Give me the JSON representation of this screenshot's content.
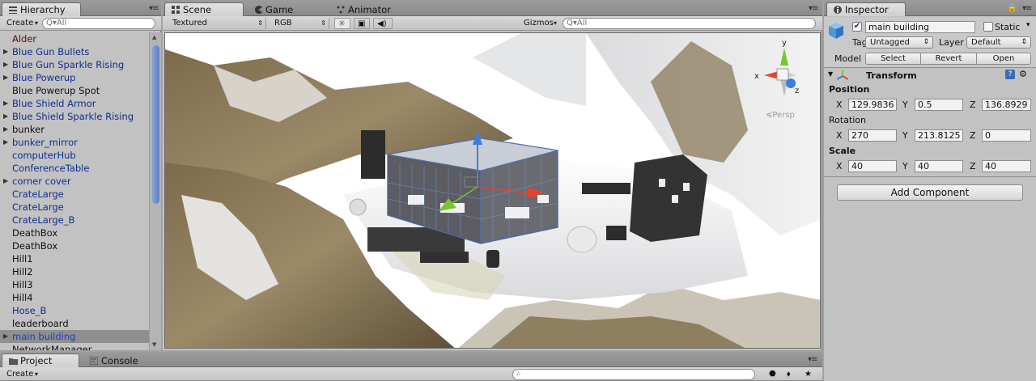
{
  "hierarchy": {
    "tab": "Hierarchy",
    "create": "Create",
    "search_placeholder": "Q▾All",
    "items": [
      {
        "label": "Alder",
        "kind": "broken",
        "fold": false
      },
      {
        "label": "Blue Gun Bullets",
        "kind": "prefab",
        "fold": true
      },
      {
        "label": "Blue Gun Sparkle Rising",
        "kind": "prefab",
        "fold": true
      },
      {
        "label": "Blue Powerup",
        "kind": "prefab",
        "fold": true
      },
      {
        "label": "Blue Powerup Spot",
        "kind": "normal",
        "fold": false
      },
      {
        "label": "Blue Shield Armor",
        "kind": "prefab",
        "fold": true
      },
      {
        "label": "Blue Shield Sparkle Rising",
        "kind": "prefab",
        "fold": true
      },
      {
        "label": "bunker",
        "kind": "normal",
        "fold": true
      },
      {
        "label": "bunker_mirror",
        "kind": "prefab",
        "fold": true
      },
      {
        "label": "computerHub",
        "kind": "prefab",
        "fold": false
      },
      {
        "label": "ConferenceTable",
        "kind": "prefab",
        "fold": false
      },
      {
        "label": "corner cover",
        "kind": "prefab",
        "fold": true
      },
      {
        "label": "CrateLarge",
        "kind": "prefab",
        "fold": false
      },
      {
        "label": "CrateLarge",
        "kind": "prefab",
        "fold": false
      },
      {
        "label": "CrateLarge_B",
        "kind": "prefab",
        "fold": false
      },
      {
        "label": "DeathBox",
        "kind": "normal",
        "fold": false
      },
      {
        "label": "DeathBox",
        "kind": "normal",
        "fold": false
      },
      {
        "label": "Hill1",
        "kind": "normal",
        "fold": false
      },
      {
        "label": "Hill2",
        "kind": "normal",
        "fold": false
      },
      {
        "label": "Hill3",
        "kind": "normal",
        "fold": false
      },
      {
        "label": "Hill4",
        "kind": "normal",
        "fold": false
      },
      {
        "label": "Hose_B",
        "kind": "prefab",
        "fold": false
      },
      {
        "label": "leaderboard",
        "kind": "normal",
        "fold": false
      },
      {
        "label": "main building",
        "kind": "selected",
        "fold": true
      },
      {
        "label": "NetworkManager",
        "kind": "normal",
        "fold": false
      }
    ]
  },
  "scene": {
    "tabs": [
      "Scene",
      "Game",
      "Animator"
    ],
    "shading": "Textured",
    "render": "RGB",
    "gizmos": "Gizmos",
    "search_placeholder": "Q▾All",
    "persp": "≼Persp",
    "axis_x": "x",
    "axis_y": "y",
    "axis_z": "z"
  },
  "inspector": {
    "tab": "Inspector",
    "object_name": "main building",
    "static_label": "Static",
    "tag_label": "Tag",
    "tag_value": "Untagged",
    "layer_label": "Layer",
    "layer_value": "Default",
    "model_label": "Model",
    "model_select": "Select",
    "model_revert": "Revert",
    "model_open": "Open",
    "transform_title": "Transform",
    "position_label": "Position",
    "position": {
      "x": "129.9836",
      "y": "0.5",
      "z": "136.8929"
    },
    "rotation_label": "Rotation",
    "rotation": {
      "x": "270",
      "y": "213.8125",
      "z": "0"
    },
    "scale_label": "Scale",
    "scale": {
      "x": "40",
      "y": "40",
      "z": "40"
    },
    "x": "X",
    "y": "Y",
    "z": "Z",
    "add_component": "Add Component"
  },
  "project": {
    "tabs": [
      "Project",
      "Console"
    ],
    "create": "Create"
  },
  "colors": {
    "selection_blue": "#5b7fc0",
    "prefab_text": "#0e2e91",
    "gizmo_x": "#e8432b",
    "gizmo_y": "#7ac52b",
    "gizmo_z": "#3a7fe0"
  }
}
